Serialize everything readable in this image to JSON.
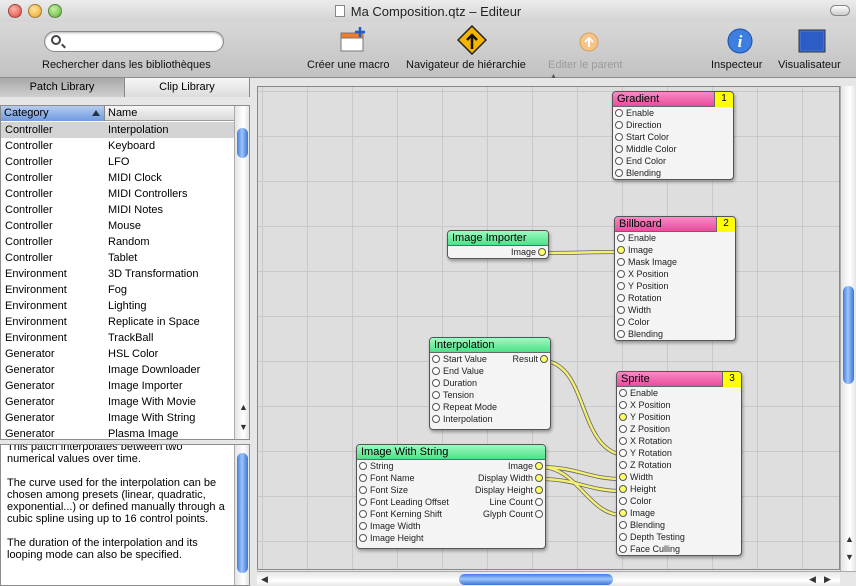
{
  "window": {
    "title": "Ma Composition.qtz – Editeur",
    "accent": "#3f7ee0"
  },
  "toolbar": {
    "search_label": "Rechercher dans les bibliothèques",
    "search_placeholder": "",
    "macro_label": "Créer une macro",
    "nav_label": "Navigateur de hiérarchie",
    "parent_label": "Editer le parent",
    "inspect_label": "Inspecteur",
    "viewer_label": "Visualisateur"
  },
  "tabs": {
    "patch": "Patch Library",
    "clip": "Clip Library"
  },
  "library": {
    "col_category": "Category",
    "col_name": "Name",
    "rows": [
      {
        "c": "Controller",
        "n": "Interpolation"
      },
      {
        "c": "Controller",
        "n": "Keyboard"
      },
      {
        "c": "Controller",
        "n": "LFO"
      },
      {
        "c": "Controller",
        "n": "MIDI Clock"
      },
      {
        "c": "Controller",
        "n": "MIDI Controllers"
      },
      {
        "c": "Controller",
        "n": "MIDI Notes"
      },
      {
        "c": "Controller",
        "n": "Mouse"
      },
      {
        "c": "Controller",
        "n": "Random"
      },
      {
        "c": "Controller",
        "n": "Tablet"
      },
      {
        "c": "Environment",
        "n": "3D Transformation"
      },
      {
        "c": "Environment",
        "n": "Fog"
      },
      {
        "c": "Environment",
        "n": "Lighting"
      },
      {
        "c": "Environment",
        "n": "Replicate in Space"
      },
      {
        "c": "Environment",
        "n": "TrackBall"
      },
      {
        "c": "Generator",
        "n": "HSL Color"
      },
      {
        "c": "Generator",
        "n": "Image Downloader"
      },
      {
        "c": "Generator",
        "n": "Image Importer"
      },
      {
        "c": "Generator",
        "n": "Image With Movie"
      },
      {
        "c": "Generator",
        "n": "Image With String"
      },
      {
        "c": "Generator",
        "n": "Plasma Image"
      }
    ]
  },
  "description": {
    "p1": "This patch interpolates between two numerical values over time.",
    "p2": "The curve used for the interpolation can be chosen among presets (linear, quadratic, exponential...) or defined manually through a cubic spline using up to 16 control points.",
    "p3": "The duration of the interpolation and its looping mode can also be specified."
  },
  "patches": {
    "gradient": {
      "title": "Gradient",
      "layer": "1",
      "inputs": [
        "Enable",
        "Direction",
        "Start Color",
        "Middle Color",
        "End Color",
        "Blending"
      ]
    },
    "importer": {
      "title": "Image Importer",
      "outputs": [
        "Image"
      ]
    },
    "billboard": {
      "title": "Billboard",
      "layer": "2",
      "inputs": [
        "Enable",
        "Image",
        "Mask Image",
        "X Position",
        "Y Position",
        "Rotation",
        "Width",
        "Color",
        "Blending"
      ]
    },
    "interpolation": {
      "title": "Interpolation",
      "inputs": [
        "Start Value",
        "End Value",
        "Duration",
        "Tension",
        "Repeat Mode",
        "Interpolation"
      ],
      "outputs": [
        "Result"
      ]
    },
    "sprite": {
      "title": "Sprite",
      "layer": "3",
      "inputs": [
        "Enable",
        "X Position",
        "Y Position",
        "Z Position",
        "X Rotation",
        "Y Rotation",
        "Z Rotation",
        "Width",
        "Height",
        "Color",
        "Image",
        "Blending",
        "Depth Testing",
        "Face Culling"
      ]
    },
    "string": {
      "title": "Image With String",
      "inputs": [
        "String",
        "Font Name",
        "Font Size",
        "Font Leading Offset",
        "Font Kerning Shift",
        "Image Width",
        "Image Height"
      ],
      "outputs": [
        "Image",
        "Display Width",
        "Display Height",
        "Line Count",
        "Glyph Count"
      ]
    }
  }
}
